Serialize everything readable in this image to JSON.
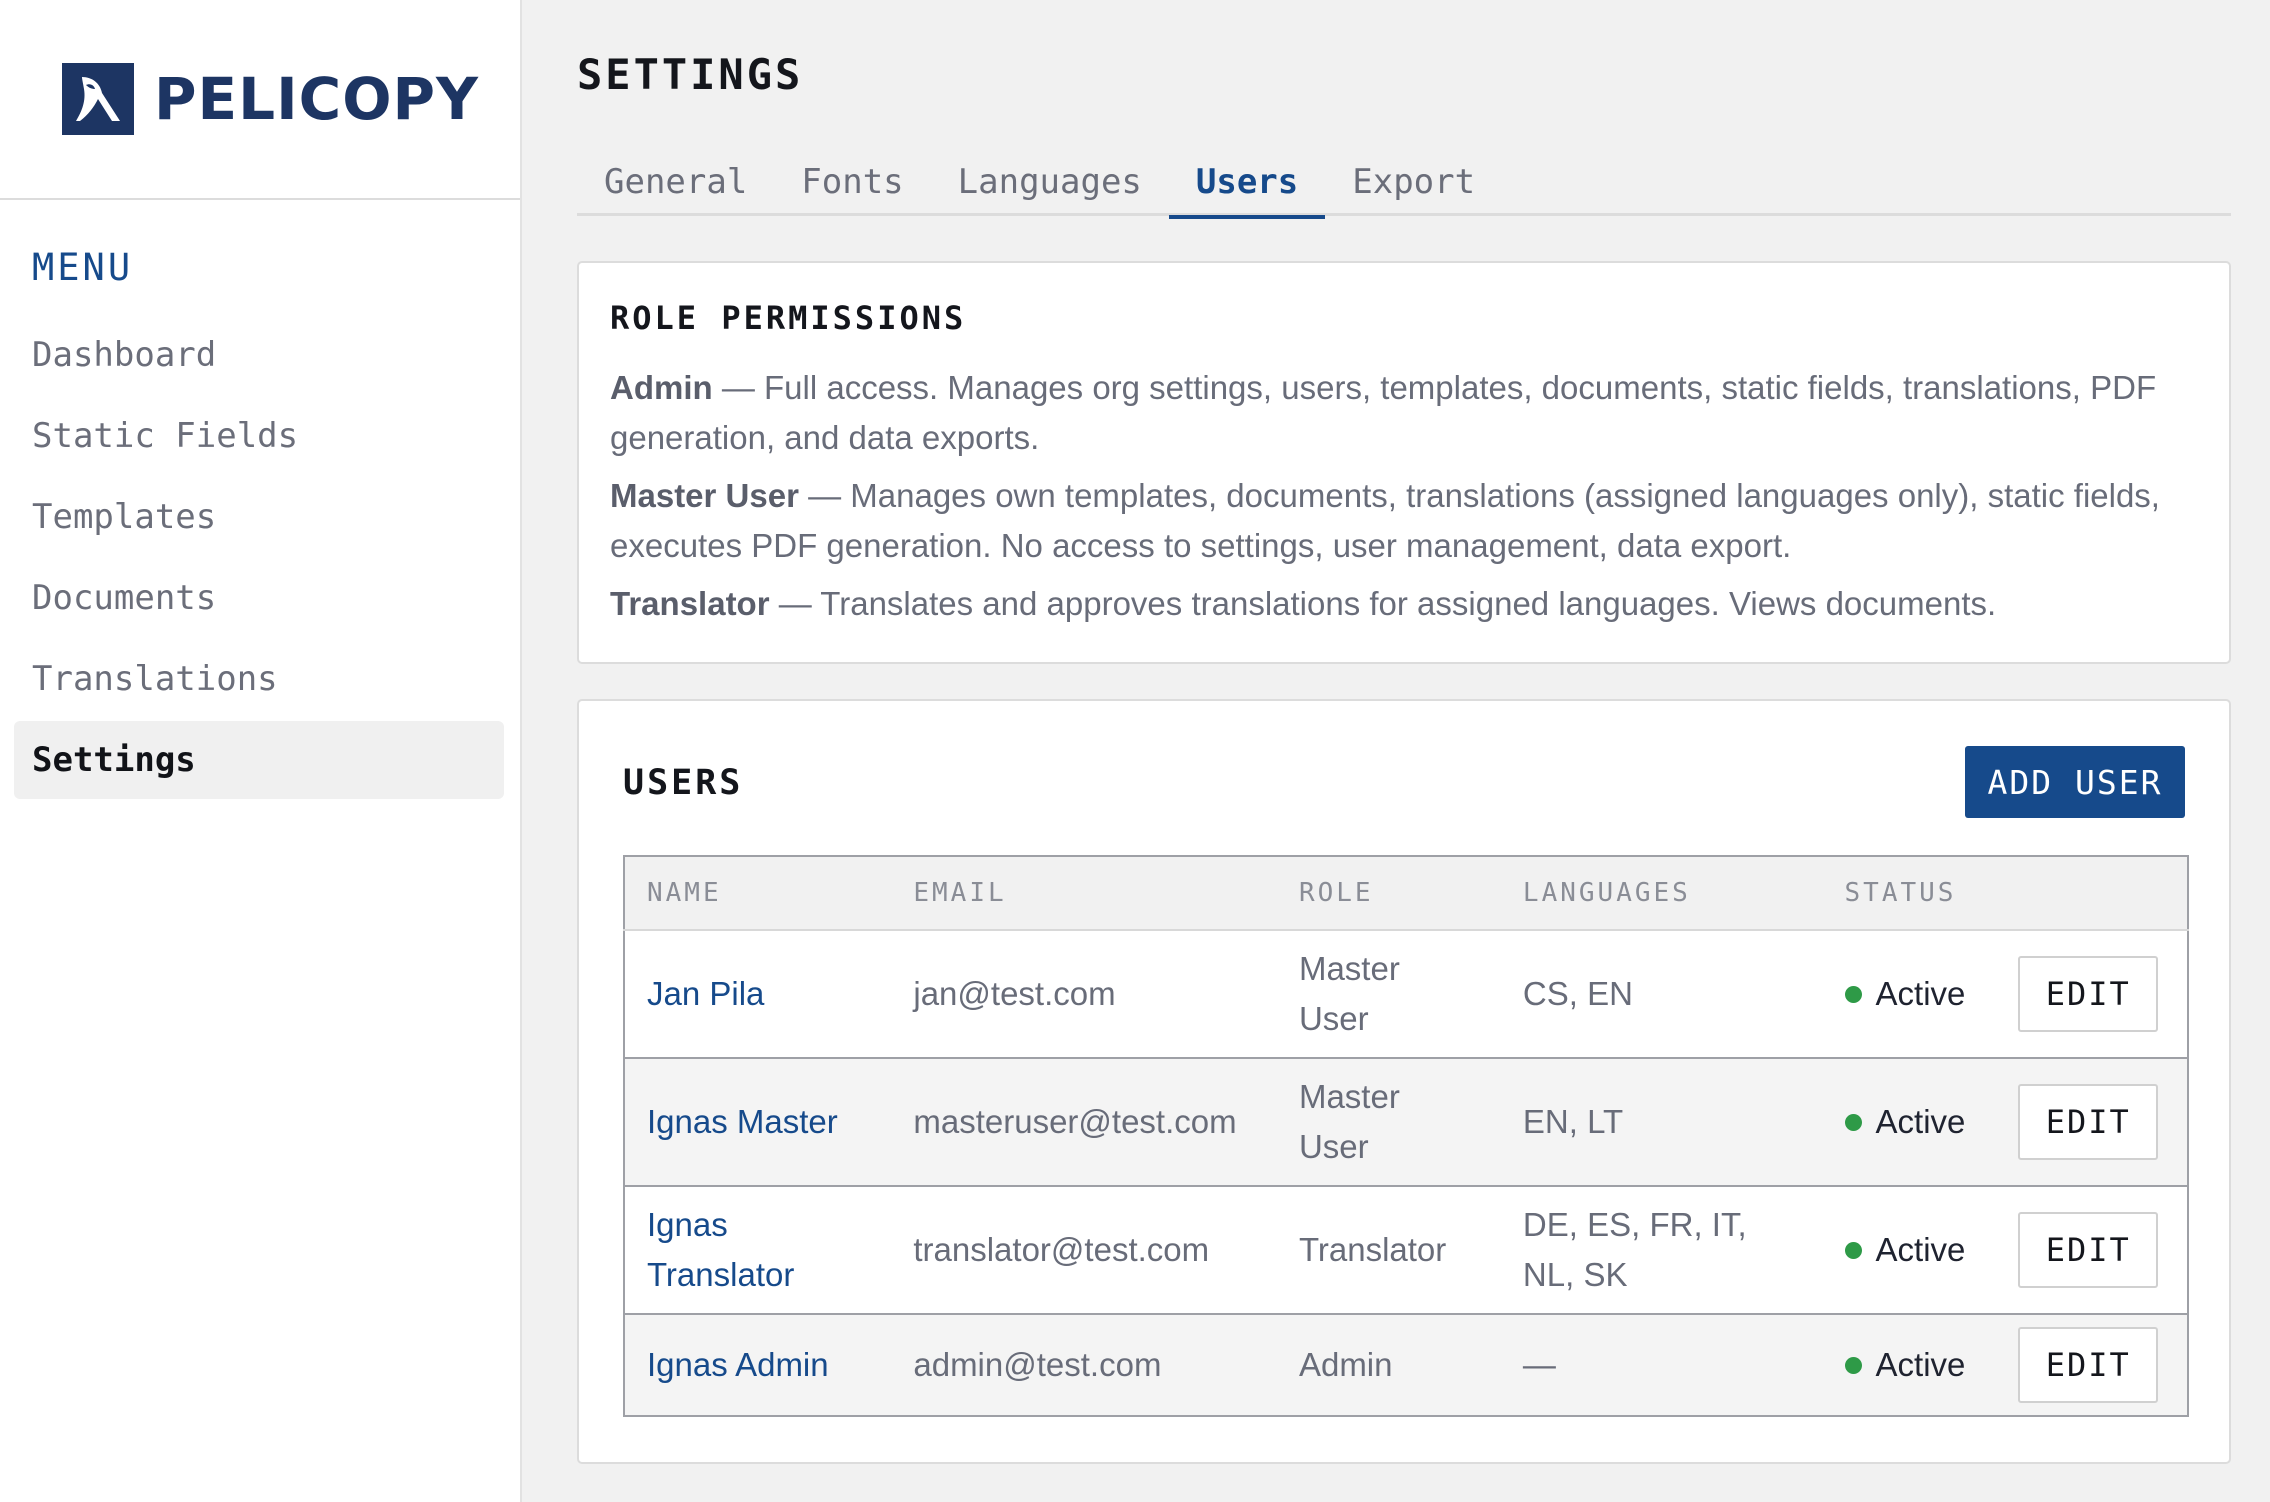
{
  "brand": {
    "name": "PELICOPY",
    "logo_icon": "pelican-logo-icon",
    "color": "#1d3563"
  },
  "sidebar": {
    "heading": "MENU",
    "items": [
      {
        "label": "Dashboard",
        "active": false
      },
      {
        "label": "Static Fields",
        "active": false
      },
      {
        "label": "Templates",
        "active": false
      },
      {
        "label": "Documents",
        "active": false
      },
      {
        "label": "Translations",
        "active": false
      },
      {
        "label": "Settings",
        "active": true
      }
    ]
  },
  "page": {
    "title": "SETTINGS"
  },
  "tabs": [
    {
      "label": "General",
      "active": false
    },
    {
      "label": "Fonts",
      "active": false
    },
    {
      "label": "Languages",
      "active": false
    },
    {
      "label": "Users",
      "active": true
    },
    {
      "label": "Export",
      "active": false
    }
  ],
  "permissions": {
    "title": "ROLE PERMISSIONS",
    "roles": [
      {
        "role": "Admin",
        "description": " — Full access. Manages org settings, users, templates, documents, static fields, translations, PDF generation, and data exports."
      },
      {
        "role": "Master User",
        "description": " — Manages own templates, documents, translations (assigned languages only), static fields, executes PDF generation. No access to settings, user management, data export."
      },
      {
        "role": "Translator",
        "description": " — Translates and approves translations for assigned languages. Views documents."
      }
    ]
  },
  "users": {
    "title": "USERS",
    "add_button": "ADD USER",
    "columns": [
      "NAME",
      "EMAIL",
      "ROLE",
      "LANGUAGES",
      "STATUS",
      ""
    ],
    "edit_label": "EDIT",
    "rows": [
      {
        "name": "Jan Pila",
        "email": "jan@test.com",
        "role": "Master User",
        "languages": "CS, EN",
        "status": "Active"
      },
      {
        "name": "Ignas Master",
        "email": "masteruser@test.com",
        "role": "Master User",
        "languages": "EN, LT",
        "status": "Active"
      },
      {
        "name": "Ignas Translator",
        "email": "translator@test.com",
        "role": "Translator",
        "languages": "DE, ES, FR, IT, NL, SK",
        "status": "Active"
      },
      {
        "name": "Ignas Admin",
        "email": "admin@test.com",
        "role": "Admin",
        "languages": "—",
        "status": "Active"
      }
    ]
  },
  "colors": {
    "accent": "#164a8b",
    "status_active": "#2e9a47"
  }
}
